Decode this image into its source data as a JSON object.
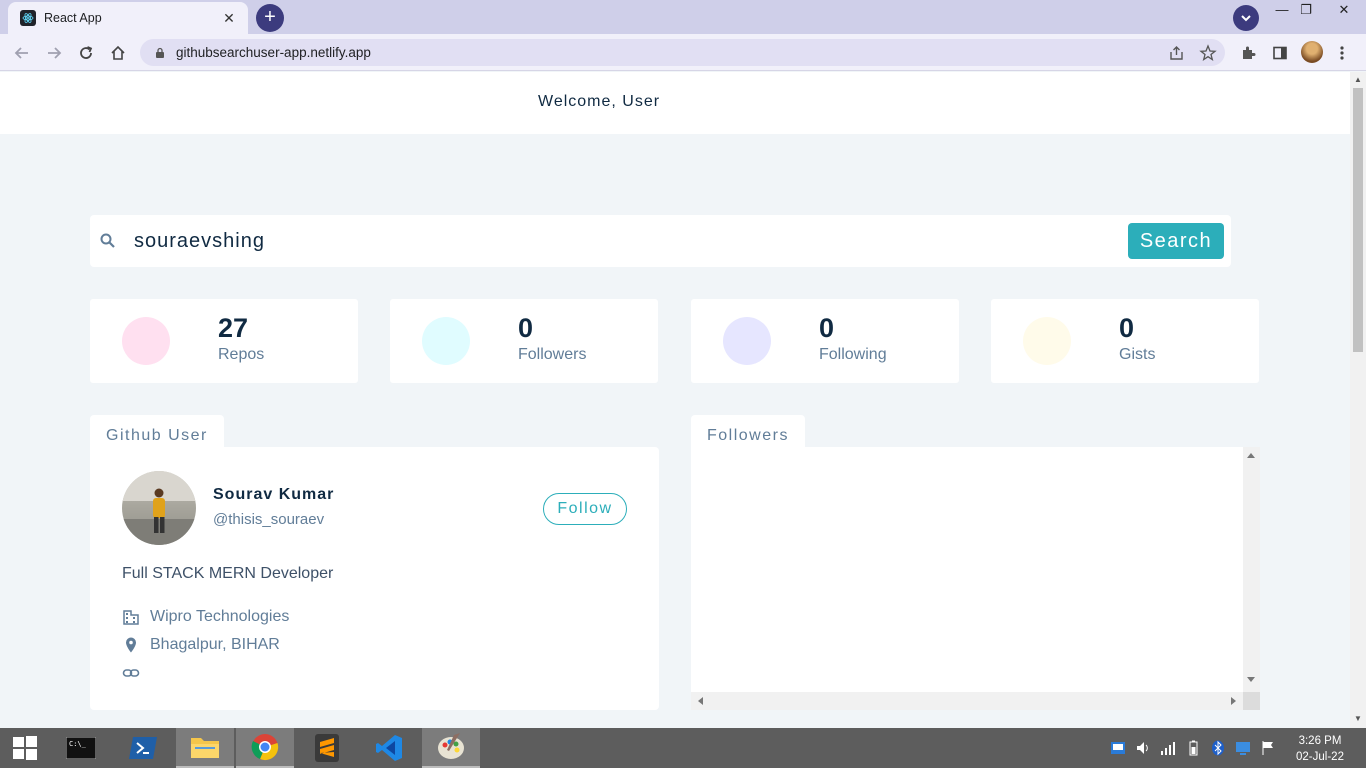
{
  "browser": {
    "tab_title": "React App",
    "url": "githubsearchuser-app.netlify.app"
  },
  "header": {
    "welcome": "Welcome, User"
  },
  "search": {
    "value": "souraevshing",
    "button_label": "Search"
  },
  "stats": [
    {
      "value": "27",
      "label": "Repos",
      "color": "#ffe0f0"
    },
    {
      "value": "0",
      "label": "Followers",
      "color": "#e0fcff"
    },
    {
      "value": "0",
      "label": "Following",
      "color": "#e6e6ff"
    },
    {
      "value": "0",
      "label": "Gists",
      "color": "#fffbea"
    }
  ],
  "user_section": {
    "tab_label": "Github User",
    "name": "Sourav Kumar",
    "handle": "@thisis_souraev",
    "follow_label": "Follow",
    "bio": "Full STACK MERN Developer",
    "company": "Wipro Technologies",
    "location": "Bhagalpur, BIHAR"
  },
  "followers_section": {
    "tab_label": "Followers"
  },
  "taskbar": {
    "time": "3:26 PM",
    "date": "02-Jul-22"
  },
  "colors": {
    "accent": "#2caeba",
    "primary_text": "#102a42",
    "secondary_text": "#617d98"
  }
}
